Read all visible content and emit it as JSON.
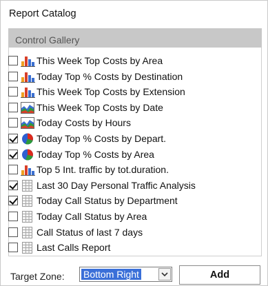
{
  "panel": {
    "title": "Report Catalog"
  },
  "gallery": {
    "header": "Control Gallery",
    "items": [
      {
        "label": "This Week Top Costs by Area",
        "checked": false,
        "icon": "bar-chart-icon"
      },
      {
        "label": "Today Top % Costs by Destination",
        "checked": false,
        "icon": "bar-chart-icon"
      },
      {
        "label": "This Week Top Costs by Extension",
        "checked": false,
        "icon": "bar-chart-icon"
      },
      {
        "label": "This Week Top Costs by Date",
        "checked": false,
        "icon": "area-chart-icon"
      },
      {
        "label": "Today Costs by Hours",
        "checked": false,
        "icon": "area-chart-icon"
      },
      {
        "label": "Today Top % Costs by Depart.",
        "checked": true,
        "icon": "pie-chart-icon"
      },
      {
        "label": "Today Top % Costs by Area",
        "checked": true,
        "icon": "pie-chart-icon"
      },
      {
        "label": "Top 5 Int. traffic by tot.duration.",
        "checked": false,
        "icon": "bar-chart-icon"
      },
      {
        "label": "Last 30 Day Personal Traffic Analysis",
        "checked": true,
        "icon": "table-grid-icon"
      },
      {
        "label": "Today Call Status by Department",
        "checked": true,
        "icon": "table-grid-icon"
      },
      {
        "label": "Today Call Status by Area",
        "checked": false,
        "icon": "table-grid-icon"
      },
      {
        "label": "Call Status of last 7 days",
        "checked": false,
        "icon": "table-grid-icon"
      },
      {
        "label": "Last Calls Report",
        "checked": false,
        "icon": "table-grid-icon"
      }
    ]
  },
  "footer": {
    "target_zone_label": "Target Zone:",
    "target_zone_value": "Bottom Right",
    "add_label": "Add"
  },
  "colors": {
    "selection": "#3a6fd8",
    "header_bg": "#c8c8c8",
    "bar_blue": "#3b6fd0",
    "bar_red": "#d8402a",
    "bar_orange": "#f0a020",
    "pie_red": "#dd2a1c",
    "pie_blue": "#2f5fd0",
    "pie_green": "#2e9a3a"
  }
}
